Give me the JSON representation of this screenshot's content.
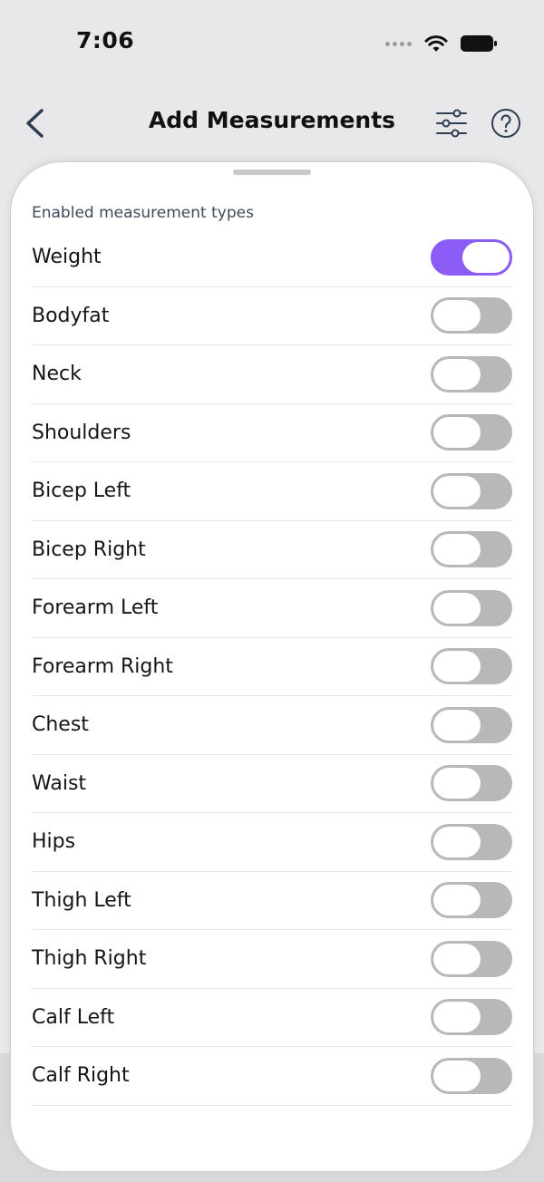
{
  "status_bar": {
    "time": "7:06",
    "icons": [
      "signal-dots-icon",
      "wifi-icon",
      "battery-icon"
    ]
  },
  "nav": {
    "title": "Add Measurements",
    "back_icon": "chevron-left-icon",
    "filter_icon": "sliders-icon",
    "help_icon": "question-circle-icon"
  },
  "colors": {
    "accent": "#8b5cf6",
    "switch_off": "#b8b8b8",
    "nav_icon": "#2f3e52"
  },
  "sheet": {
    "section_label": "Enabled measurement types",
    "items": [
      {
        "label": "Weight",
        "enabled": true
      },
      {
        "label": "Bodyfat",
        "enabled": false
      },
      {
        "label": "Neck",
        "enabled": false
      },
      {
        "label": "Shoulders",
        "enabled": false
      },
      {
        "label": "Bicep Left",
        "enabled": false
      },
      {
        "label": "Bicep Right",
        "enabled": false
      },
      {
        "label": "Forearm Left",
        "enabled": false
      },
      {
        "label": "Forearm Right",
        "enabled": false
      },
      {
        "label": "Chest",
        "enabled": false
      },
      {
        "label": "Waist",
        "enabled": false
      },
      {
        "label": "Hips",
        "enabled": false
      },
      {
        "label": "Thigh Left",
        "enabled": false
      },
      {
        "label": "Thigh Right",
        "enabled": false
      },
      {
        "label": "Calf Left",
        "enabled": false
      },
      {
        "label": "Calf Right",
        "enabled": false
      }
    ]
  }
}
